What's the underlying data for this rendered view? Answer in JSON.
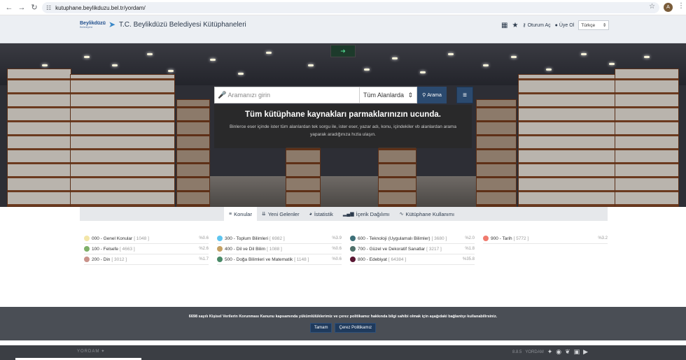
{
  "browser": {
    "url": "kutuphane.beylikduzu.bel.tr/yordam/",
    "profile_initial": "A"
  },
  "header": {
    "logo_brand": "Beylikdüzü",
    "logo_sub": "Belediyesi",
    "title": "T.C. Beylikdüzü Belediyesi Kütüphaneleri",
    "login_label": "Oturum Aç",
    "member_label": "Üye Ol",
    "language": "Türkçe"
  },
  "search": {
    "placeholder": "Aramanızı girin",
    "scope": "Tüm Alanlarda",
    "button_label": "Arama",
    "tagline": "Tüm kütüphane kaynakları parmaklarınızın ucunda.",
    "description": "Binlerce eser içinde ister tüm alanlardan tek sorgu ile, ister eser, yazar adı, konu, içindekiler vb alanlardan arama yaparak aradığınıza hızla ulaşın."
  },
  "tabs": [
    {
      "label": "Konular",
      "icon": "list-icon",
      "active": true
    },
    {
      "label": "Yeni Gelenler",
      "icon": "chevrons-down-icon",
      "active": false
    },
    {
      "label": "İstatistik",
      "icon": "pie-chart-icon",
      "active": false
    },
    {
      "label": "İçerik Dağılımı",
      "icon": "signal-bars-icon",
      "active": false
    },
    {
      "label": "Kütüphane Kullanımı",
      "icon": "line-chart-icon",
      "active": false
    }
  ],
  "categories": [
    [
      {
        "name": "000 - Genel Konular",
        "count": "[ 1048 ]",
        "percent": "%0.6",
        "color": "#f3e6a8"
      },
      {
        "name": "100 - Felsefe",
        "count": "[ 4663 ]",
        "percent": "%2.6",
        "color": "#7fb069"
      },
      {
        "name": "200 - Din",
        "count": "[ 3012 ]",
        "percent": "%1.7",
        "color": "#c9928a"
      }
    ],
    [
      {
        "name": "300 - Toplum Bilimleri",
        "count": "[ 6982 ]",
        "percent": "%3.9",
        "color": "#5ec5ef"
      },
      {
        "name": "400 - Dil ve Dil Bilim",
        "count": "[ 1088 ]",
        "percent": "%0.6",
        "color": "#c4a164"
      },
      {
        "name": "500 - Doğa Bilimleri ve Matematik",
        "count": "[ 1148 ]",
        "percent": "%0.6",
        "color": "#4a8a68"
      }
    ],
    [
      {
        "name": "600 - Teknoloji (Uygulamalı Bilimler)",
        "count": "[ 3680 ]",
        "percent": "%2.0",
        "color": "#3d6f78"
      },
      {
        "name": "700 - Güzel ve Dekoratif Sanatlar",
        "count": "[ 3217 ]",
        "percent": "%1.8",
        "color": "#50706a"
      },
      {
        "name": "800 - Edebiyat",
        "count": "[ 64384 ]",
        "percent": "%35.8",
        "color": "#5a1733"
      }
    ],
    [
      {
        "name": "900 - Tarih",
        "count": "[ 5772 ]",
        "percent": "%3.2",
        "color": "#f07a6e"
      }
    ]
  ],
  "cookie": {
    "text": "6698 sayılı Kişisel Verilerin Korunması Kanunu kapsamında yükümlülüklerimiz ve çerez politikamız hakkında bilgi sahibi olmak için aşağıdaki bağlantıyı kullanabilirsiniz.",
    "ok_label": "Tamam",
    "policy_label": "Çerez Politikamız"
  },
  "footer": {
    "brand": "YORDAM",
    "version": "8.8.5",
    "brand_right": "YORDAM"
  }
}
